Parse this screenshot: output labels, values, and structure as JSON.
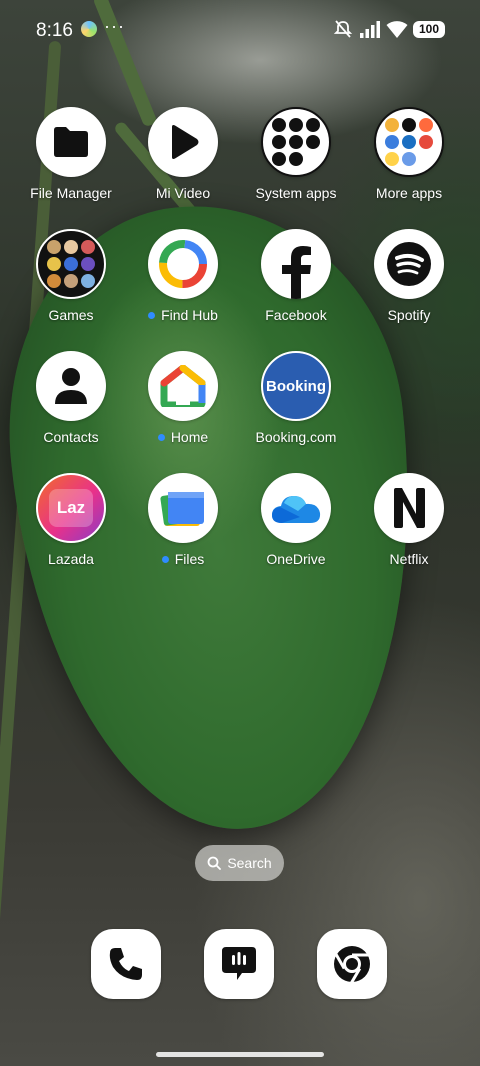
{
  "status_bar": {
    "time": "8:16",
    "more_indicator": "···",
    "battery": "100",
    "icons": [
      "app-notification-icon",
      "mute-icon",
      "signal-icon",
      "wifi-icon",
      "battery-icon"
    ]
  },
  "apps": [
    {
      "label": "File Manager",
      "icon": "folder-icon",
      "has_dot": false
    },
    {
      "label": "Mi Video",
      "icon": "play-icon",
      "has_dot": false
    },
    {
      "label": "System apps",
      "icon": "folder-group-icon",
      "has_dot": false
    },
    {
      "label": "More apps",
      "icon": "folder-group-icon",
      "has_dot": false
    },
    {
      "label": "Games",
      "icon": "folder-group-icon",
      "has_dot": false
    },
    {
      "label": "Find Hub",
      "icon": "find-hub-icon",
      "has_dot": true
    },
    {
      "label": "Facebook",
      "icon": "facebook-icon",
      "has_dot": false
    },
    {
      "label": "Spotify",
      "icon": "spotify-icon",
      "has_dot": false
    },
    {
      "label": "Contacts",
      "icon": "contacts-icon",
      "has_dot": false
    },
    {
      "label": "Home",
      "icon": "google-home-icon",
      "has_dot": true
    },
    {
      "label": "Booking.com",
      "icon": "booking-icon",
      "has_dot": false
    },
    {
      "label": "Lazada",
      "icon": "lazada-icon",
      "has_dot": false
    },
    {
      "label": "Files",
      "icon": "files-icon",
      "has_dot": true
    },
    {
      "label": "OneDrive",
      "icon": "onedrive-icon",
      "has_dot": false
    },
    {
      "label": "Netflix",
      "icon": "netflix-icon",
      "has_dot": false
    }
  ],
  "booking_text": "Booking",
  "lazada_text": "Laz",
  "search": {
    "label": "Search"
  },
  "dock": [
    {
      "icon": "phone-icon"
    },
    {
      "icon": "messages-icon"
    },
    {
      "icon": "chrome-icon"
    }
  ],
  "colors": {
    "notification_dot": "#2f8cff",
    "booking_blue": "#2a5db0",
    "lazada_pink": "#e8318a"
  }
}
